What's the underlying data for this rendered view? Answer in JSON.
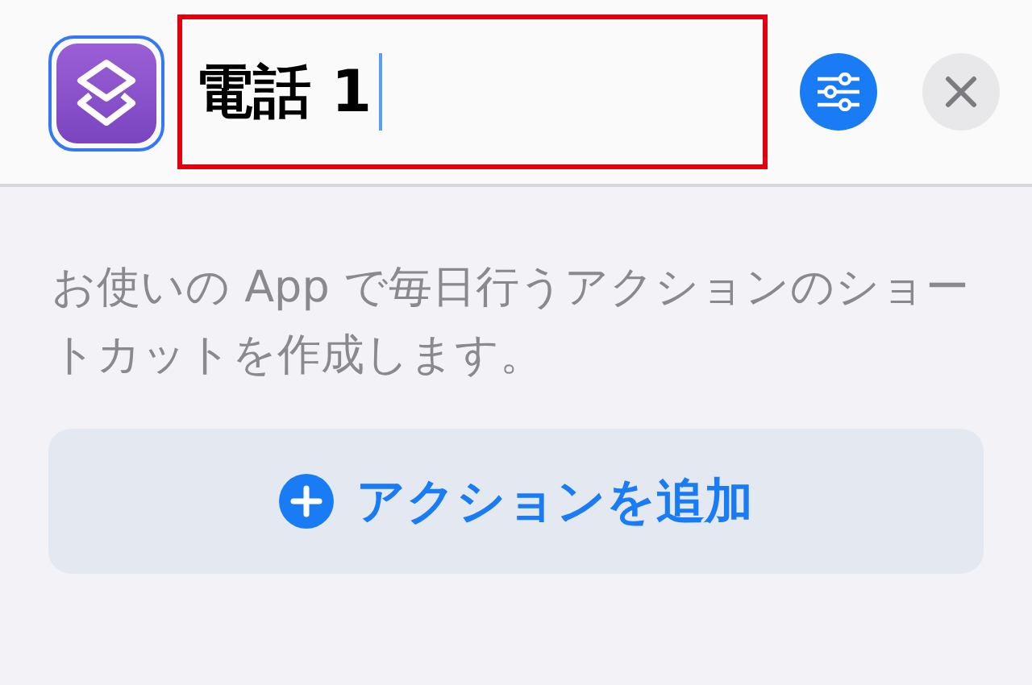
{
  "shortcut": {
    "name": "電話 1",
    "icon_selected": true
  },
  "description": "お使いの App で毎日行うアクションのショートカットを作成します。",
  "add_action_button": {
    "label": "アクションを追加"
  }
}
